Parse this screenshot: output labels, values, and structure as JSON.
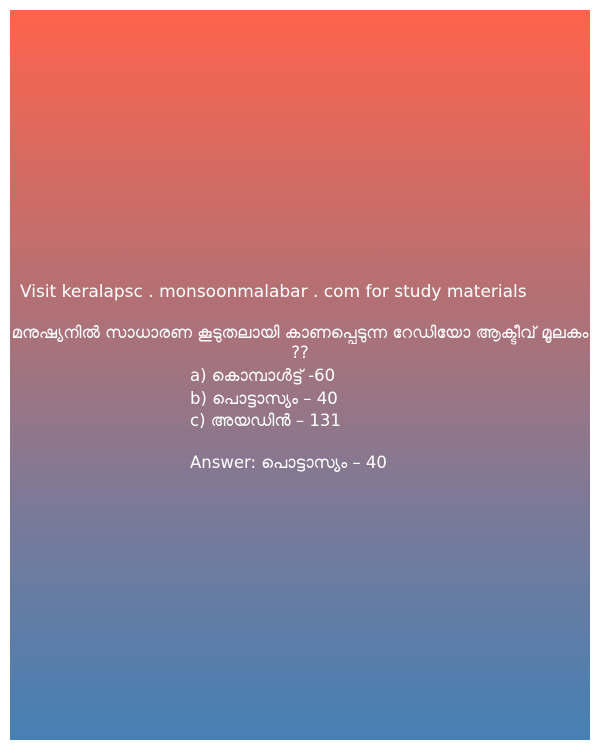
{
  "banner": {
    "site_text": "Visit keralapsc . monsoonmalabar . com for study materials"
  },
  "quiz": {
    "question": "മനുഷ്യനിൽ സാധാരണ കൂടുതലായി കാണപ്പെടുന്ന റേഡിയോ ആക്ടീവ് മൂലകം ??",
    "options": [
      "a) കൊമ്പാൾട്ട് -60",
      "b) പൊട്ടാസ്യം – 40",
      "c) അയഡിൻ – 131"
    ],
    "answer": "Answer: പൊട്ടാസ്യം – 40"
  },
  "colors": {
    "gradient_top": "#fe634b",
    "gradient_bottom": "#4580b4",
    "text": "#ffffff"
  }
}
